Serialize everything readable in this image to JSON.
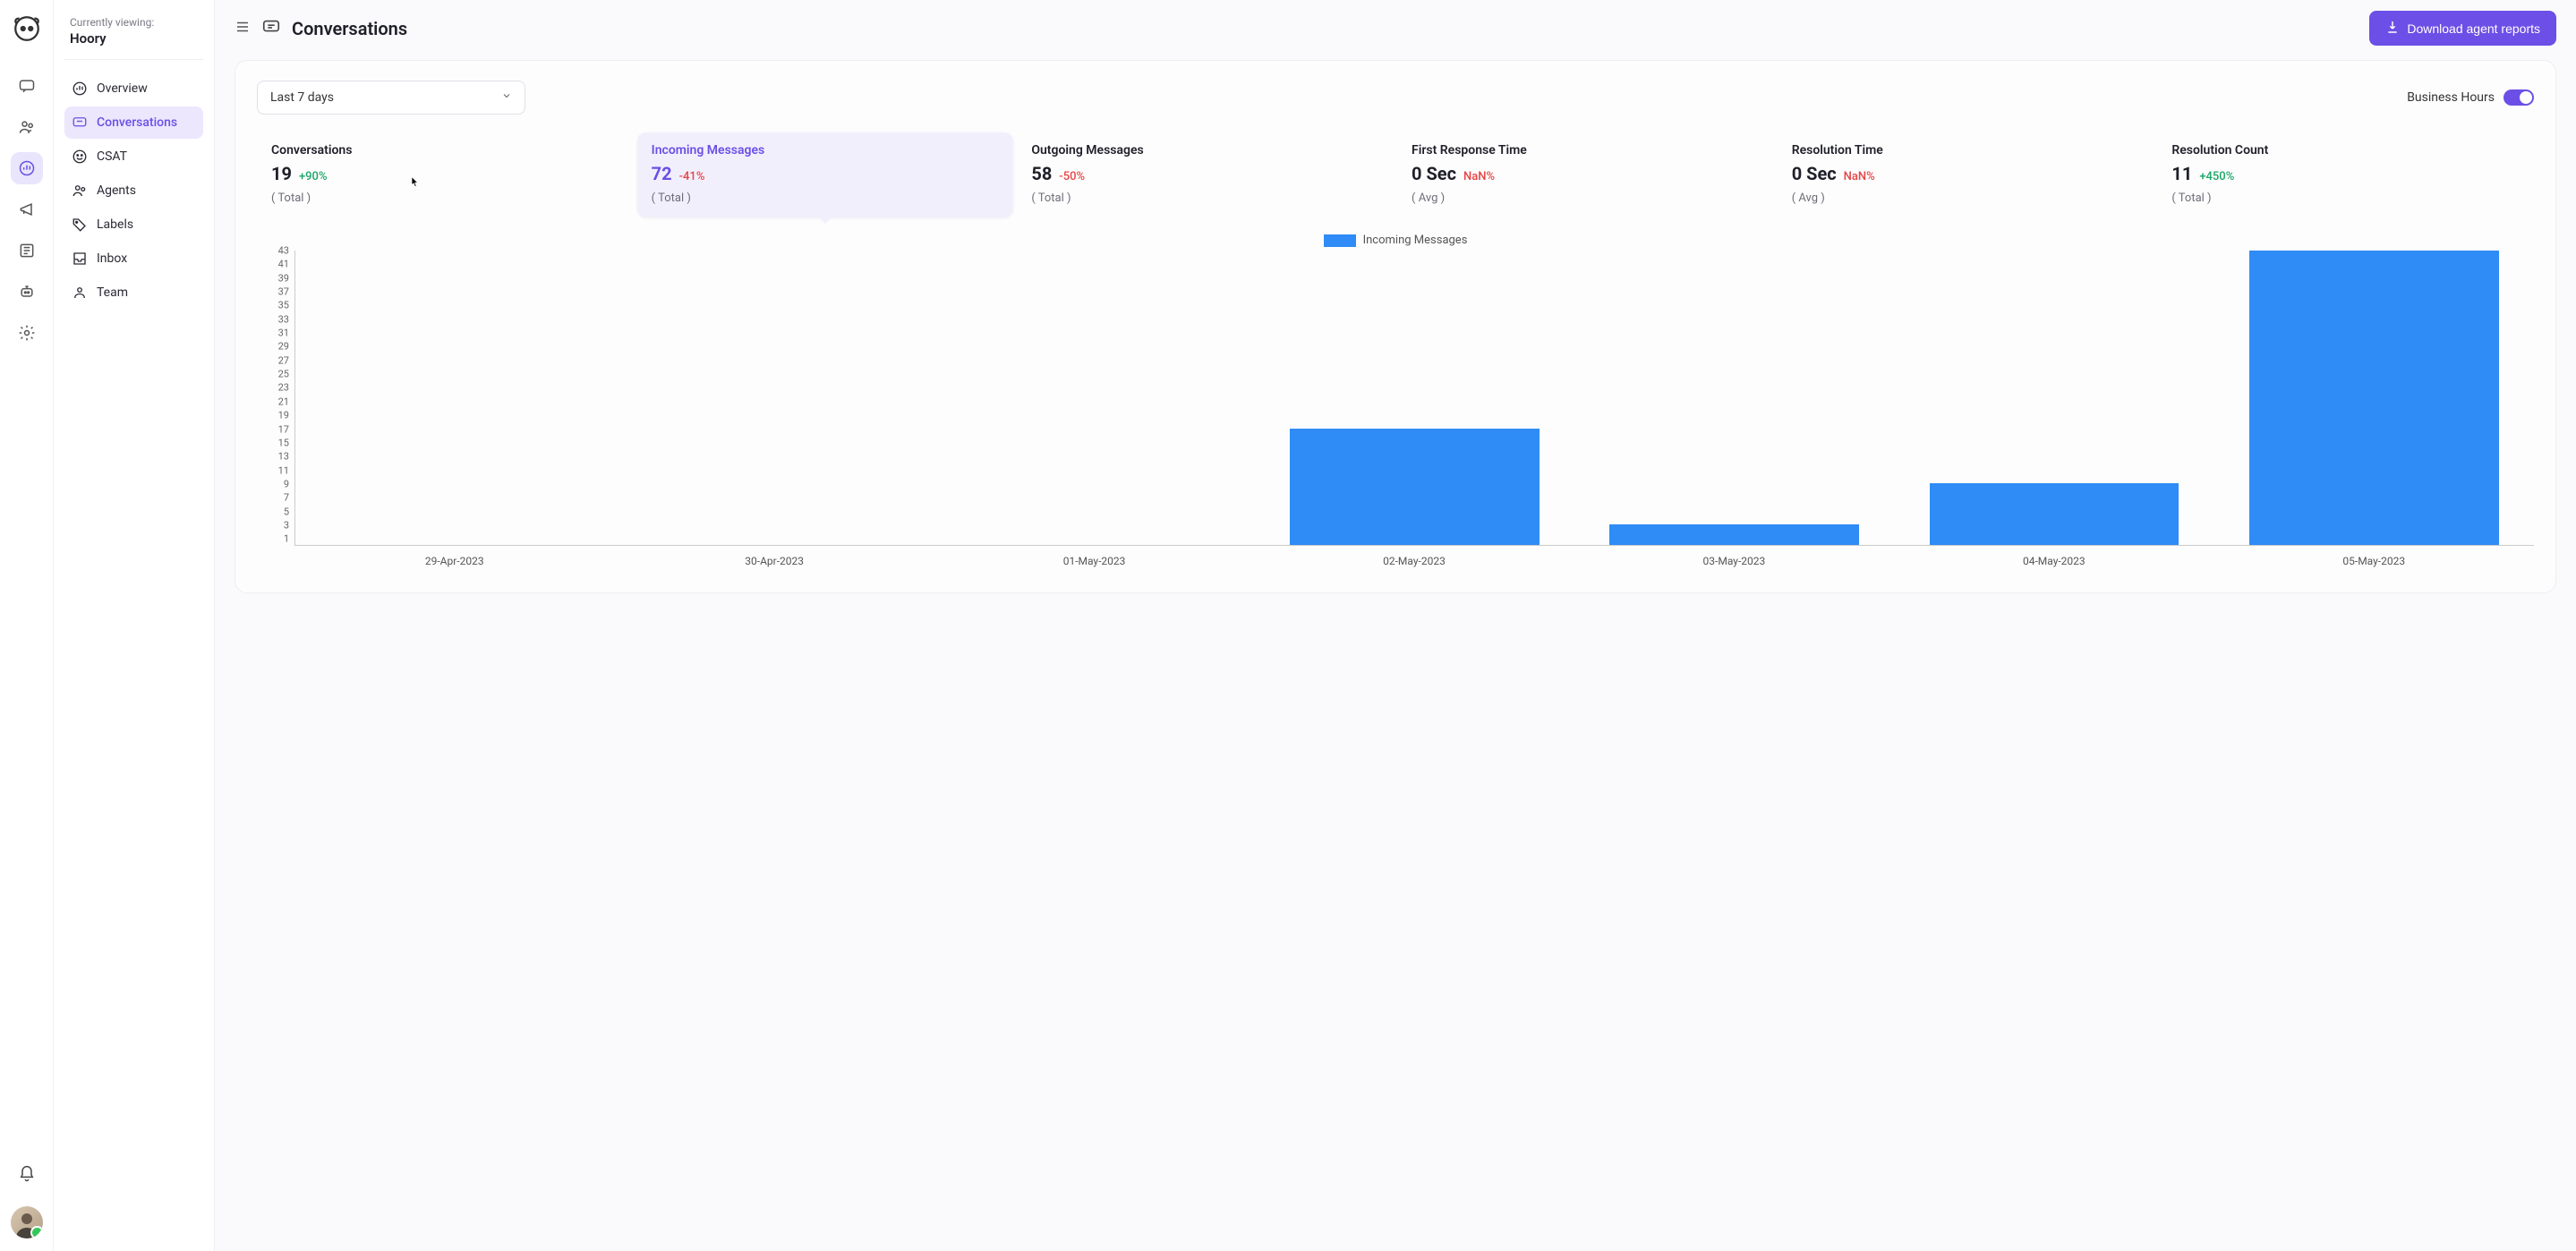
{
  "context": {
    "label": "Currently viewing:",
    "name": "Hoory"
  },
  "rail": {
    "icons": [
      "messages-icon",
      "contacts-icon",
      "reports-icon",
      "campaigns-icon",
      "library-icon",
      "bot-icon",
      "settings-icon"
    ],
    "active_index": 2
  },
  "sidebar": {
    "items": [
      {
        "label": "Overview",
        "icon": "chart-icon"
      },
      {
        "label": "Conversations",
        "icon": "chat-icon"
      },
      {
        "label": "CSAT",
        "icon": "smile-icon"
      },
      {
        "label": "Agents",
        "icon": "users-icon"
      },
      {
        "label": "Labels",
        "icon": "tag-icon"
      },
      {
        "label": "Inbox",
        "icon": "inbox-icon"
      },
      {
        "label": "Team",
        "icon": "team-icon"
      }
    ],
    "active_index": 1
  },
  "header": {
    "title": "Conversations",
    "download_btn": "Download agent reports"
  },
  "dropdown": {
    "selected": "Last 7 days"
  },
  "business_hours": {
    "label": "Business Hours",
    "on": true
  },
  "stats": [
    {
      "title": "Conversations",
      "value": "19",
      "delta": "+90%",
      "delta_sign": "pos",
      "sub": "( Total )"
    },
    {
      "title": "Incoming Messages",
      "value": "72",
      "delta": "-41%",
      "delta_sign": "neg",
      "sub": "( Total )"
    },
    {
      "title": "Outgoing Messages",
      "value": "58",
      "delta": "-50%",
      "delta_sign": "neg",
      "sub": "( Total )"
    },
    {
      "title": "First Response Time",
      "value": "0 Sec",
      "delta": "NaN%",
      "delta_sign": "neg",
      "sub": "( Avg )"
    },
    {
      "title": "Resolution Time",
      "value": "0 Sec",
      "delta": "NaN%",
      "delta_sign": "neg",
      "sub": "( Avg )"
    },
    {
      "title": "Resolution Count",
      "value": "11",
      "delta": "+450%",
      "delta_sign": "pos",
      "sub": "( Total )"
    }
  ],
  "selected_stat_index": 1,
  "chart_data": {
    "type": "bar",
    "legend": "Incoming Messages",
    "categories": [
      "29-Apr-2023",
      "30-Apr-2023",
      "01-May-2023",
      "02-May-2023",
      "03-May-2023",
      "04-May-2023",
      "05-May-2023"
    ],
    "values": [
      0,
      0,
      0,
      17,
      3,
      9,
      43
    ],
    "y_ticks": [
      1,
      3,
      5,
      7,
      9,
      11,
      13,
      15,
      17,
      19,
      21,
      23,
      25,
      27,
      29,
      31,
      33,
      35,
      37,
      39,
      41,
      43
    ],
    "ylim": [
      0,
      43
    ],
    "color": "#2f8bf5"
  }
}
